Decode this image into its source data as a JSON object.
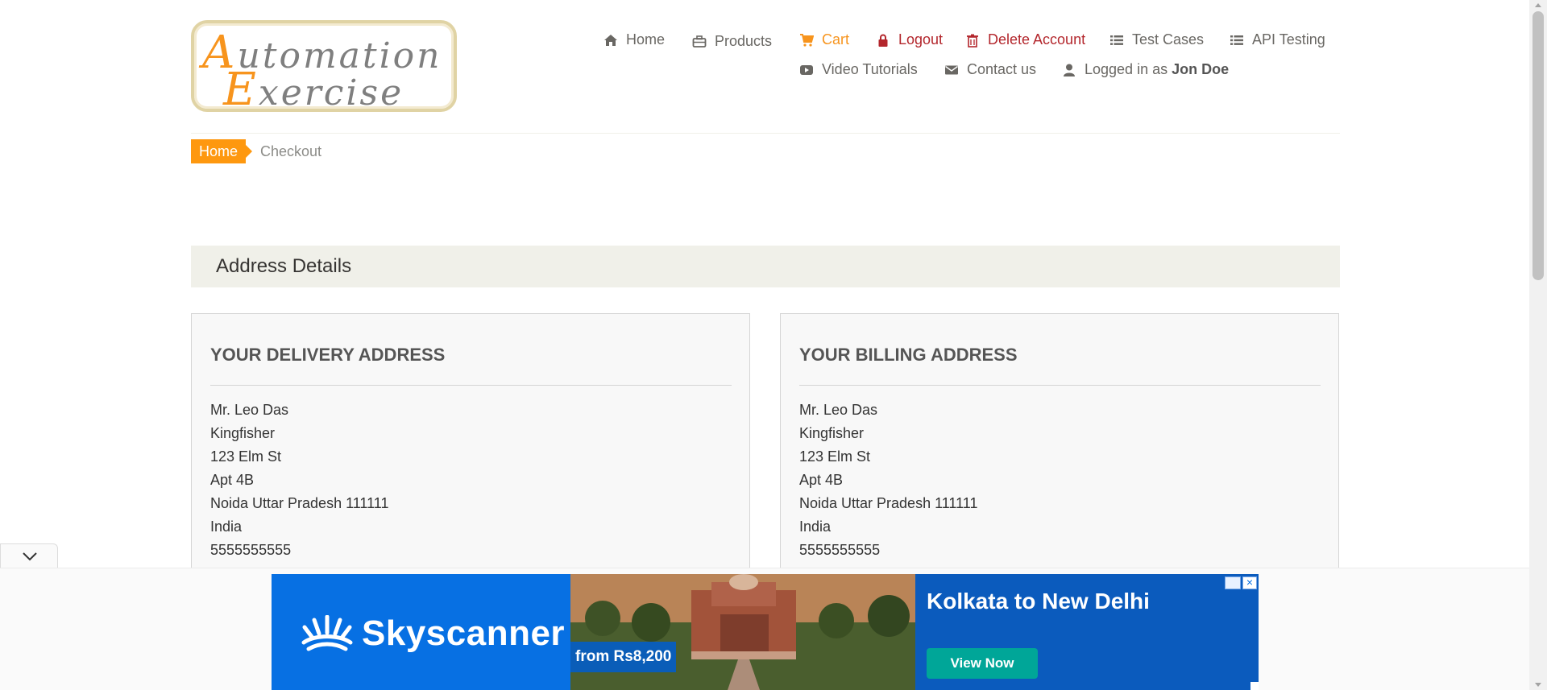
{
  "logo": {
    "line1_cap": "A",
    "line1_rest": "utomation",
    "line2_cap": "E",
    "line2_rest": "xercise"
  },
  "nav": {
    "home": "Home",
    "products": "Products",
    "cart": "Cart",
    "logout": "Logout",
    "delete_account": "Delete Account",
    "test_cases": "Test Cases",
    "api_testing": "API Testing",
    "video_tutorials": "Video Tutorials",
    "contact_us": "Contact us",
    "logged_in_prefix": "Logged in as",
    "username": "Jon Doe"
  },
  "breadcrumb": {
    "home": "Home",
    "current": "Checkout"
  },
  "address_section": {
    "title": "Address Details"
  },
  "delivery": {
    "heading": "YOUR DELIVERY ADDRESS",
    "lines": [
      "Mr. Leo Das",
      "Kingfisher",
      "123 Elm St",
      "Apt 4B",
      "Noida Uttar Pradesh 111111",
      "India",
      "5555555555"
    ]
  },
  "billing": {
    "heading": "YOUR BILLING ADDRESS",
    "lines": [
      "Mr. Leo Das",
      "Kingfisher",
      "123 Elm St",
      "Apt 4B",
      "Noida Uttar Pradesh 111111",
      "India",
      "5555555555"
    ]
  },
  "ad": {
    "brand": "Skyscanner",
    "price": "from Rs8,200",
    "headline": "Kolkata to New Delhi",
    "cta": "View Now",
    "colors": {
      "background": "#0770e3",
      "cta": "#00a698"
    }
  },
  "colors": {
    "accent": "#fe980f",
    "danger": "#b3262c",
    "section_bg": "#f0f0e9"
  }
}
